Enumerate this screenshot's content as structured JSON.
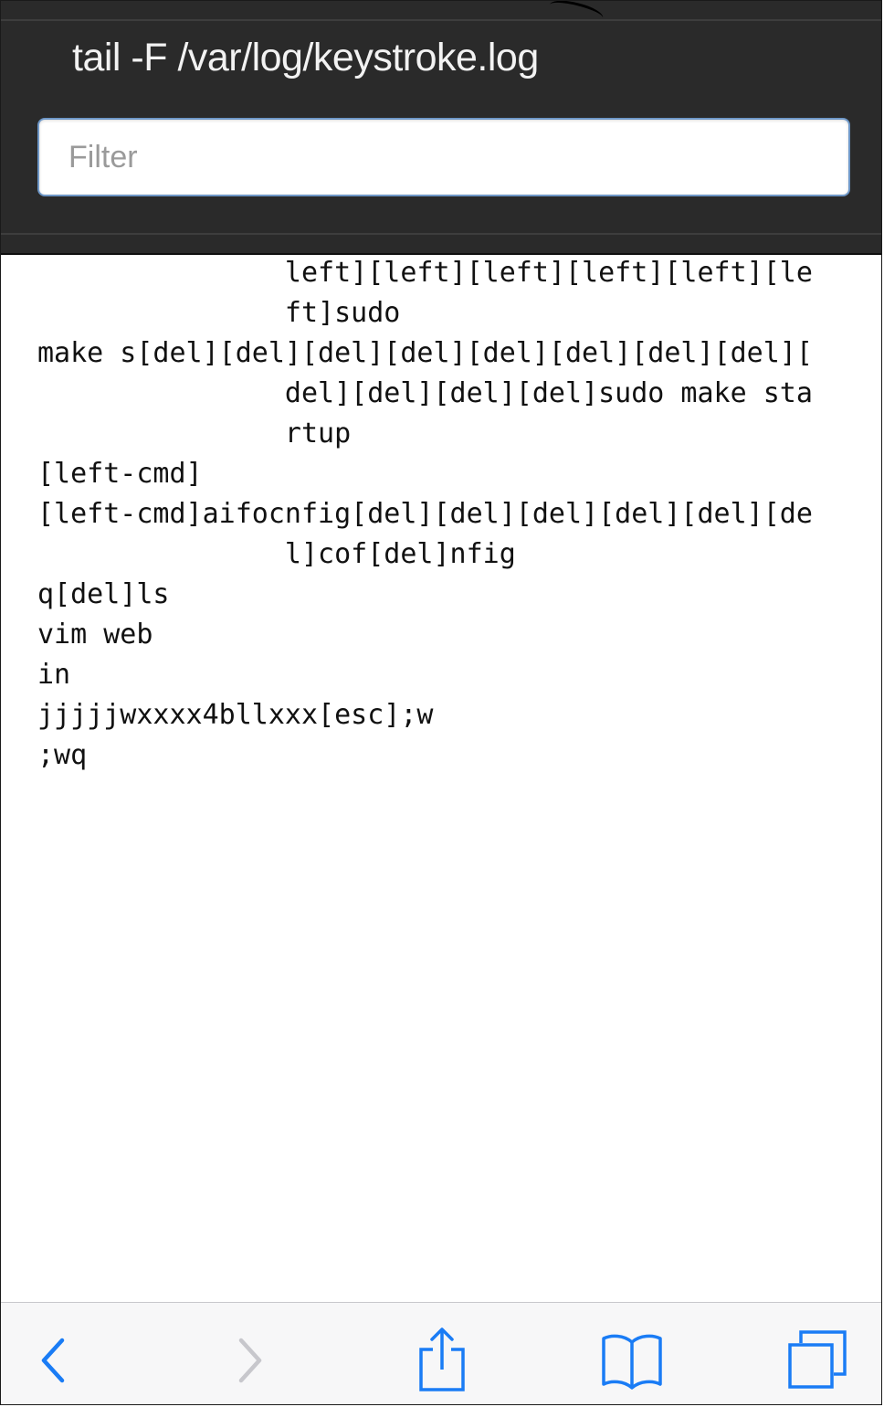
{
  "header": {
    "title": "tail -F /var/log/keystroke.log"
  },
  "filter": {
    "placeholder": "Filter",
    "value": ""
  },
  "log": {
    "lines": [
      "               left][left][left][left][left][le",
      "               ft]sudo",
      "make s[del][del][del][del][del][del][del][del][",
      "               del][del][del][del]sudo make sta",
      "               rtup",
      "[left-cmd]",
      "[left-cmd]aifocnfig[del][del][del][del][del][de",
      "               l]cof[del]nfig",
      "q[del]ls",
      "vim web",
      "in",
      "jjjjjwxxxx4bllxxx[esc];w",
      ";wq"
    ]
  },
  "toolbar": {
    "icons": [
      "back-chevron-icon",
      "forward-chevron-icon",
      "share-icon",
      "bookmarks-book-icon",
      "tabs-icon"
    ],
    "accent_color": "#1a7cf5",
    "disabled_color": "#c7c7cc"
  }
}
